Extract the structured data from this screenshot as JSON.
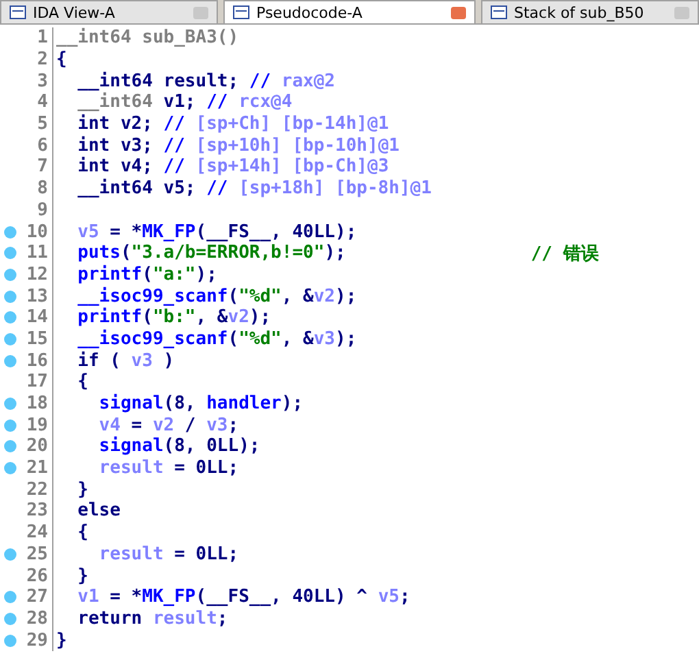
{
  "tabs": [
    {
      "label": "IDA View-A",
      "selected": false
    },
    {
      "label": "Pseudocode-A",
      "selected": true
    },
    {
      "label": "Stack of sub_B50",
      "selected": false
    }
  ],
  "lines": [
    {
      "number": "1",
      "marked": false,
      "tokens": [
        {
          "kind": "gray",
          "text": "__int64 sub_BA3()"
        }
      ]
    },
    {
      "number": "2",
      "marked": false,
      "tokens": [
        {
          "kind": "plain",
          "text": "{"
        }
      ]
    },
    {
      "number": "3",
      "marked": false,
      "tokens": [
        {
          "kind": "plain",
          "text": "  __int64 result; "
        },
        {
          "kind": "cmt",
          "text": "// "
        },
        {
          "kind": "var",
          "text": "rax@2"
        }
      ]
    },
    {
      "number": "4",
      "marked": false,
      "tokens": [
        {
          "kind": "gray",
          "text": "  __int64 "
        },
        {
          "kind": "plain",
          "text": "v1; "
        },
        {
          "kind": "cmt",
          "text": "// "
        },
        {
          "kind": "var",
          "text": "rcx@4"
        }
      ]
    },
    {
      "number": "5",
      "marked": false,
      "tokens": [
        {
          "kind": "plain",
          "text": "  int v2; "
        },
        {
          "kind": "cmt",
          "text": "// "
        },
        {
          "kind": "var",
          "text": "[sp+Ch] [bp-14h]@1"
        }
      ]
    },
    {
      "number": "6",
      "marked": false,
      "tokens": [
        {
          "kind": "plain",
          "text": "  int v3; "
        },
        {
          "kind": "cmt",
          "text": "// "
        },
        {
          "kind": "var",
          "text": "[sp+10h] [bp-10h]@1"
        }
      ]
    },
    {
      "number": "7",
      "marked": false,
      "tokens": [
        {
          "kind": "plain",
          "text": "  int v4; "
        },
        {
          "kind": "cmt",
          "text": "// "
        },
        {
          "kind": "var",
          "text": "[sp+14h] [bp-Ch]@3"
        }
      ]
    },
    {
      "number": "8",
      "marked": false,
      "tokens": [
        {
          "kind": "plain",
          "text": "  __int64 v5; "
        },
        {
          "kind": "cmt",
          "text": "// "
        },
        {
          "kind": "var",
          "text": "[sp+18h] [bp-8h]@1"
        }
      ]
    },
    {
      "number": "9",
      "marked": false
    },
    {
      "number": "10",
      "marked": true,
      "tokens": [
        {
          "kind": "var",
          "text": "  v5"
        },
        {
          "kind": "plain",
          "text": " = *"
        },
        {
          "kind": "func",
          "text": "MK_FP"
        },
        {
          "kind": "plain",
          "text": "(__FS__, 40LL);"
        }
      ]
    },
    {
      "number": "11",
      "marked": true,
      "tokens": [
        {
          "kind": "func",
          "text": "  puts"
        },
        {
          "kind": "plain",
          "text": "("
        },
        {
          "kind": "str",
          "text": "\"3.a/b=ERROR,b!=0\""
        },
        {
          "kind": "plain",
          "text": ");"
        }
      ],
      "comment": "// 错误"
    },
    {
      "number": "12",
      "marked": true,
      "tokens": [
        {
          "kind": "func",
          "text": "  printf"
        },
        {
          "kind": "plain",
          "text": "("
        },
        {
          "kind": "str",
          "text": "\"a:\""
        },
        {
          "kind": "plain",
          "text": ");"
        }
      ]
    },
    {
      "number": "13",
      "marked": true,
      "tokens": [
        {
          "kind": "func",
          "text": "  __isoc99_scanf"
        },
        {
          "kind": "plain",
          "text": "("
        },
        {
          "kind": "str",
          "text": "\"%d\""
        },
        {
          "kind": "plain",
          "text": ", &"
        },
        {
          "kind": "var",
          "text": "v2"
        },
        {
          "kind": "plain",
          "text": ");"
        }
      ]
    },
    {
      "number": "14",
      "marked": true,
      "tokens": [
        {
          "kind": "func",
          "text": "  printf"
        },
        {
          "kind": "plain",
          "text": "("
        },
        {
          "kind": "str",
          "text": "\"b:\""
        },
        {
          "kind": "plain",
          "text": ", &"
        },
        {
          "kind": "var",
          "text": "v2"
        },
        {
          "kind": "plain",
          "text": ");"
        }
      ]
    },
    {
      "number": "15",
      "marked": true,
      "tokens": [
        {
          "kind": "func",
          "text": "  __isoc99_scanf"
        },
        {
          "kind": "plain",
          "text": "("
        },
        {
          "kind": "str",
          "text": "\"%d\""
        },
        {
          "kind": "plain",
          "text": ", &"
        },
        {
          "kind": "var",
          "text": "v3"
        },
        {
          "kind": "plain",
          "text": ");"
        }
      ]
    },
    {
      "number": "16",
      "marked": true,
      "tokens": [
        {
          "kind": "plain",
          "text": "  if ( "
        },
        {
          "kind": "var",
          "text": "v3"
        },
        {
          "kind": "plain",
          "text": " )"
        }
      ]
    },
    {
      "number": "17",
      "marked": false,
      "tokens": [
        {
          "kind": "plain",
          "text": "  {"
        }
      ]
    },
    {
      "number": "18",
      "marked": true,
      "tokens": [
        {
          "kind": "func",
          "text": "    signal"
        },
        {
          "kind": "plain",
          "text": "(8, "
        },
        {
          "kind": "func",
          "text": "handler"
        },
        {
          "kind": "plain",
          "text": ");"
        }
      ]
    },
    {
      "number": "19",
      "marked": true,
      "tokens": [
        {
          "kind": "var",
          "text": "    v4"
        },
        {
          "kind": "plain",
          "text": " = "
        },
        {
          "kind": "var",
          "text": "v2"
        },
        {
          "kind": "plain",
          "text": " / "
        },
        {
          "kind": "var",
          "text": "v3"
        },
        {
          "kind": "plain",
          "text": ";"
        }
      ]
    },
    {
      "number": "20",
      "marked": true,
      "tokens": [
        {
          "kind": "func",
          "text": "    signal"
        },
        {
          "kind": "plain",
          "text": "(8, 0LL);"
        }
      ]
    },
    {
      "number": "21",
      "marked": true,
      "tokens": [
        {
          "kind": "var",
          "text": "    result"
        },
        {
          "kind": "plain",
          "text": " = 0LL;"
        }
      ]
    },
    {
      "number": "22",
      "marked": false,
      "tokens": [
        {
          "kind": "plain",
          "text": "  }"
        }
      ]
    },
    {
      "number": "23",
      "marked": false,
      "tokens": [
        {
          "kind": "plain",
          "text": "  else"
        }
      ]
    },
    {
      "number": "24",
      "marked": false,
      "tokens": [
        {
          "kind": "plain",
          "text": "  {"
        }
      ]
    },
    {
      "number": "25",
      "marked": true,
      "tokens": [
        {
          "kind": "var",
          "text": "    result"
        },
        {
          "kind": "plain",
          "text": " = 0LL;"
        }
      ]
    },
    {
      "number": "26",
      "marked": false,
      "tokens": [
        {
          "kind": "plain",
          "text": "  }"
        }
      ]
    },
    {
      "number": "27",
      "marked": true,
      "tokens": [
        {
          "kind": "var",
          "text": "  v1"
        },
        {
          "kind": "plain",
          "text": " = *"
        },
        {
          "kind": "func",
          "text": "MK_FP"
        },
        {
          "kind": "plain",
          "text": "(__FS__, 40LL) ^ "
        },
        {
          "kind": "var",
          "text": "v5"
        },
        {
          "kind": "plain",
          "text": ";"
        }
      ]
    },
    {
      "number": "28",
      "marked": true,
      "tokens": [
        {
          "kind": "plain",
          "text": "  return "
        },
        {
          "kind": "var",
          "text": "result"
        },
        {
          "kind": "plain",
          "text": ";"
        }
      ]
    },
    {
      "number": "29",
      "marked": true,
      "tokens": [
        {
          "kind": "plain",
          "text": "}"
        }
      ]
    }
  ]
}
